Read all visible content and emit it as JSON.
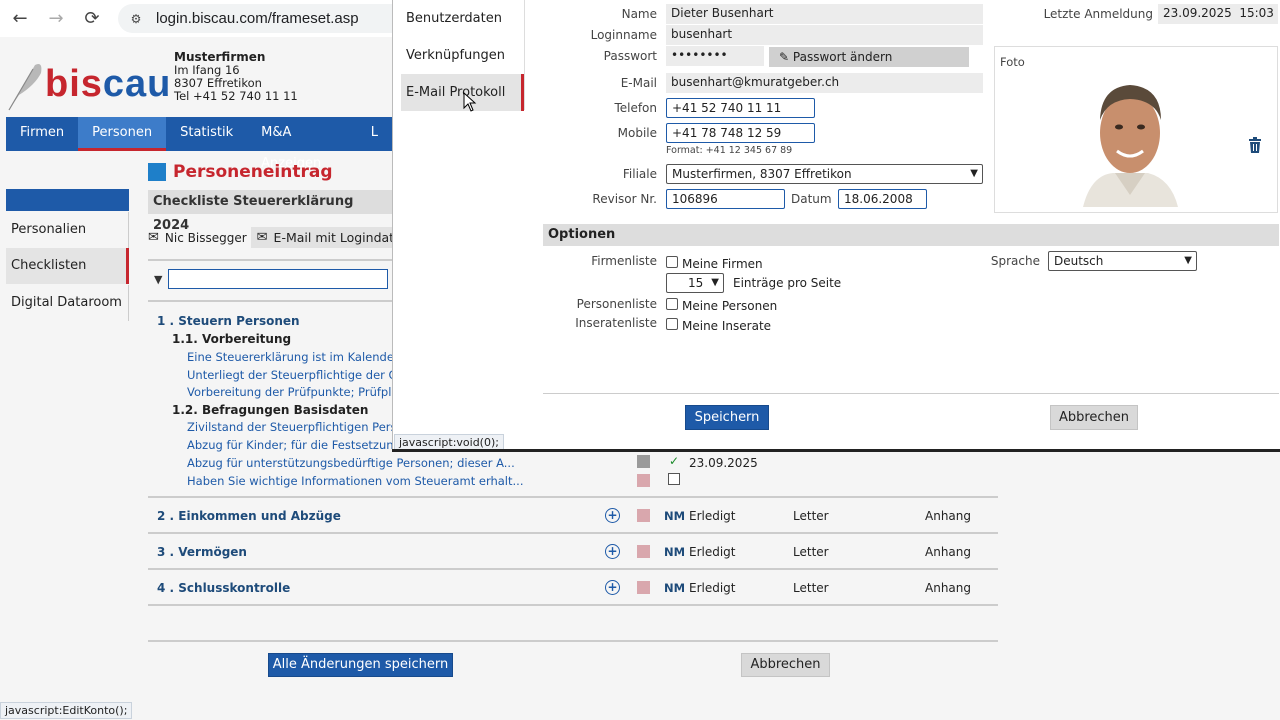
{
  "browser": {
    "url": "login.biscau.com/frameset.asp",
    "back_icon": "←",
    "forward_icon": "→",
    "reload_icon": "⟳",
    "tune_icon": "⚙"
  },
  "logo": {
    "text_b": "bis",
    "text_s": "cau"
  },
  "company": {
    "name": "Musterfirmen",
    "street": "Im Ifang 16",
    "city": "8307 Effretikon",
    "phone": "Tel +41 52 740 11 11"
  },
  "main_nav": [
    {
      "label": "Firmen"
    },
    {
      "label": "Personen"
    },
    {
      "label": "Statistik"
    },
    {
      "label": "M&A Anzeigen"
    },
    {
      "label": "L"
    }
  ],
  "sidebar": {
    "items": [
      {
        "label": "Personalien"
      },
      {
        "label": "Checklisten"
      },
      {
        "label": "Digital Dataroom"
      }
    ]
  },
  "section": {
    "title": "Personeneintrag",
    "checklist_title": "Checkliste Steuererklärung 2024",
    "person_mail": "Nic Bissegger",
    "mail_button": "E-Mail mit Logindat"
  },
  "tree": {
    "group1": "1 . Steuern Personen",
    "sub1": "1.1. Vorbereitung",
    "items1": [
      "Eine Steuererklärung ist im Kalender",
      "Unterliegt der Steuerpflichtige der Q",
      "Vorbereitung der Prüfpunkte; Prüfpla"
    ],
    "sub2": "1.2. Befragungen Basisdaten",
    "items2": [
      "Zivilstand der Steuerpflichtigen Perso",
      "Abzug für Kinder; für die Festsetzung",
      "Abzug für unterstützungsbedürftige Personen; dieser A...",
      "Haben Sie wichtige Informationen vom Steueramt erhalt..."
    ],
    "check_date": "23.09.2025",
    "check_mark": "✓"
  },
  "rows": [
    {
      "label": "2 . Einkommen und Abzüge",
      "nm": "NM",
      "status": "Erledigt",
      "letter": "Letter",
      "anhang": "Anhang"
    },
    {
      "label": "3 . Vermögen",
      "nm": "NM",
      "status": "Erledigt",
      "letter": "Letter",
      "anhang": "Anhang"
    },
    {
      "label": "4 . Schlusskontrolle",
      "nm": "NM",
      "status": "Erledigt",
      "letter": "Letter",
      "anhang": "Anhang"
    }
  ],
  "bottom_buttons": {
    "save_all": "Alle Änderungen speichern",
    "cancel": "Abbrechen"
  },
  "status_tips": {
    "tip1": "javascript:void(0);",
    "tip2": "javascript:EditKonto();"
  },
  "overlay": {
    "menu": [
      {
        "label": "Benutzerdaten"
      },
      {
        "label": "Verknüpfungen"
      },
      {
        "label": "E-Mail Protokoll"
      }
    ],
    "labels": {
      "name": "Name",
      "loginname": "Loginname",
      "passwort": "Passwort",
      "email": "E-Mail",
      "telefon": "Telefon",
      "mobile": "Mobile",
      "filiale": "Filiale",
      "revisor": "Revisor Nr.",
      "datum": "Datum",
      "letzte": "Letzte Anmeldung",
      "foto": "Foto"
    },
    "values": {
      "name": "Dieter Busenhart",
      "loginname": "busenhart",
      "passwort": "••••••••",
      "email": "busenhart@kmuratgeber.ch",
      "telefon": "+41 52 740 11 11",
      "mobile": "+41 78 748 12 59",
      "format_hint": "Format: +41 12 345 67 89",
      "filiale": "Musterfirmen, 8307 Effretikon",
      "revisor": "106896",
      "datum": "18.06.2008",
      "letzte": "23.09.2025  15:03"
    },
    "pw_button": "Passwort ändern",
    "options": {
      "header": "Optionen",
      "firmenliste": "Firmenliste",
      "meine_firmen": "Meine Firmen",
      "per_page": "15",
      "per_page_label": "Einträge pro Seite",
      "personenliste": "Personenliste",
      "meine_personen": "Meine Personen",
      "inseratenliste": "Inseratenliste",
      "meine_inserate": "Meine Inserate",
      "sprache": "Sprache",
      "sprache_value": "Deutsch"
    },
    "save": "Speichern",
    "cancel": "Abbrechen"
  }
}
